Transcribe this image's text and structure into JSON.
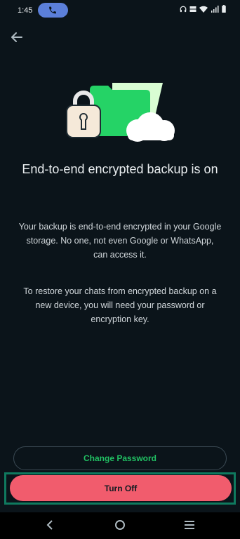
{
  "status_bar": {
    "time": "1:45",
    "icons": [
      "headphones-icon",
      "volte-icon",
      "wifi-icon",
      "signal-icon",
      "battery-icon"
    ]
  },
  "header": {
    "back_icon": "arrow-left-icon"
  },
  "content": {
    "title": "End-to-end encrypted backup is on",
    "paragraph1": "Your backup is end-to-end encrypted in your Google storage. No one, not even Google or WhatsApp, can access it.",
    "paragraph2": "To restore your chats from encrypted backup on a new device, you will need your password or encryption key."
  },
  "actions": {
    "change_password_label": "Change Password",
    "turn_off_label": "Turn Off"
  },
  "colors": {
    "background": "#0b141a",
    "accent_green": "#21c063",
    "danger_red": "#f15c6d",
    "highlight_outline": "#0f7a5f"
  }
}
